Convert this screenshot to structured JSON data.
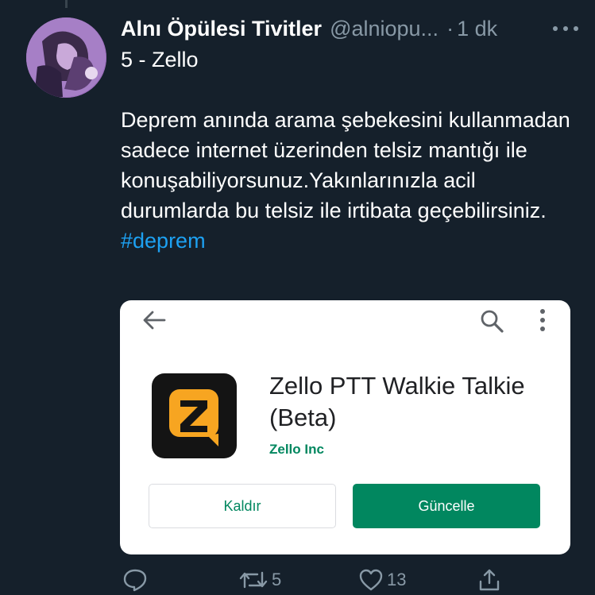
{
  "tweet": {
    "display_name": "Alnı Öpülesi Tivitler",
    "handle": "@alniopu...",
    "separator": "·",
    "time": "1 dk",
    "title": "5 - Zello",
    "body": "Deprem anında arama şebekesini kullanmadan sadece internet üzerinden telsiz mantığı ile konuşabiliyorsunuz.Yakınlarınızla acil durumlarda bu telsiz ile irtibata geçebilirsiniz.",
    "hashtag": "#deprem"
  },
  "card": {
    "app_title": "Zello PTT Walkie Talkie (Beta)",
    "developer": "Zello Inc",
    "uninstall_label": "Kaldır",
    "update_label": "Güncelle"
  },
  "actions": {
    "retweet_count": "5",
    "like_count": "13"
  },
  "colors": {
    "background": "#15202b",
    "muted_text": "#8899a6",
    "link": "#1da1f2",
    "play_green": "#01875f",
    "zello_orange": "#f7a521"
  },
  "icons": [
    "more-icon",
    "back-arrow-icon",
    "search-icon",
    "overflow-menu-icon",
    "zello-logo-icon",
    "reply-icon",
    "retweet-icon",
    "like-icon",
    "share-icon"
  ]
}
